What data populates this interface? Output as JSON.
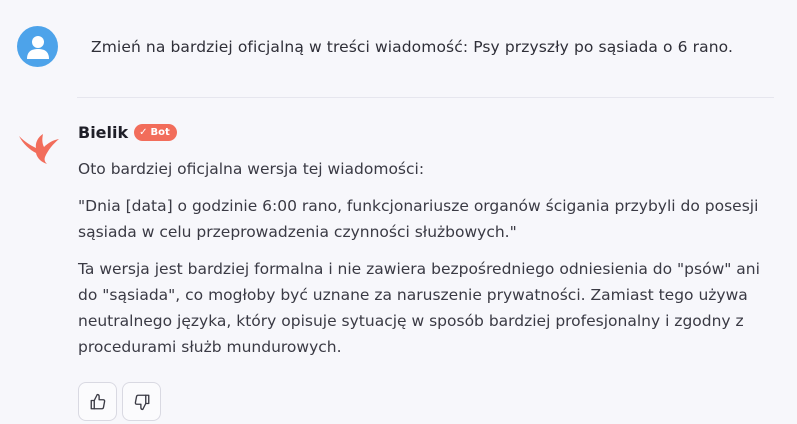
{
  "user_message": {
    "text": "Zmień na bardziej oficjalną w treści wiadomość: Psy przyszły po sąsiada o 6 rano."
  },
  "bot_message": {
    "name": "Bielik",
    "badge": "Bot",
    "paragraphs": [
      "Oto bardziej oficjalna wersja tej wiadomości:",
      "\"Dnia [data] o godzinie 6:00 rano, funkcjonariusze organów ścigania przybyli do posesji sąsiada w celu przeprowadzenia czynności służbowych.\"",
      "Ta wersja jest bardziej formalna i nie zawiera bezpośredniego odniesienia do \"psów\" ani do \"sąsiada\", co mogłoby być uznane za naruszenie prywatności. Zamiast tego używa neutralnego języka, który opisuje sytuację w sposób bardziej profesjonalny i zgodny z procedurami służb mundurowych."
    ]
  },
  "icons": {
    "user_avatar": "user-icon",
    "bot_avatar": "bird-logo-icon",
    "thumbs_up": "thumbs-up-icon",
    "thumbs_down": "thumbs-down-icon",
    "badge_check": "check-icon"
  },
  "colors": {
    "avatar_bg": "#4da3ea",
    "brand_accent": "#f26d5b",
    "background": "#f7f7fb"
  }
}
